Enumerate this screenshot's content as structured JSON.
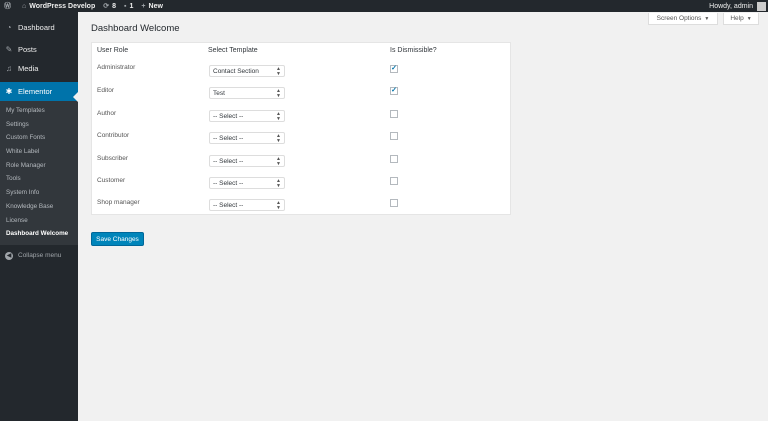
{
  "adminbar": {
    "site_name": "WordPress Develop",
    "updates_count": "8",
    "comments_count": "1",
    "new_label": "New",
    "greeting": "Howdy, admin"
  },
  "sidebar": {
    "dashboard": "Dashboard",
    "posts": "Posts",
    "media": "Media",
    "elementor": "Elementor",
    "submenu": [
      "My Templates",
      "Settings",
      "Custom Fonts",
      "White Label",
      "Role Manager",
      "Tools",
      "System Info",
      "Knowledge Base",
      "License",
      "Dashboard Welcome"
    ],
    "collapse": "Collapse menu"
  },
  "screen_meta": {
    "screen_options": "Screen Options",
    "help": "Help"
  },
  "page": {
    "title": "Dashboard Welcome",
    "table": {
      "headers": [
        "User Role",
        "Select Template",
        "Is Dismissible?"
      ],
      "rows": [
        {
          "role": "Administrator",
          "template": "Contact Section",
          "dismissible": true
        },
        {
          "role": "Editor",
          "template": "Test",
          "dismissible": true
        },
        {
          "role": "Author",
          "template": "-- Select --",
          "dismissible": false
        },
        {
          "role": "Contributor",
          "template": "-- Select --",
          "dismissible": false
        },
        {
          "role": "Subscriber",
          "template": "-- Select --",
          "dismissible": false
        },
        {
          "role": "Customer",
          "template": "-- Select --",
          "dismissible": false
        },
        {
          "role": "Shop manager",
          "template": "-- Select --",
          "dismissible": false
        }
      ]
    },
    "save_label": "Save Changes"
  },
  "colors": {
    "admin_dark": "#23282d",
    "submenu_bg": "#32373c",
    "accent": "#0073aa",
    "button": "#0085ba"
  }
}
